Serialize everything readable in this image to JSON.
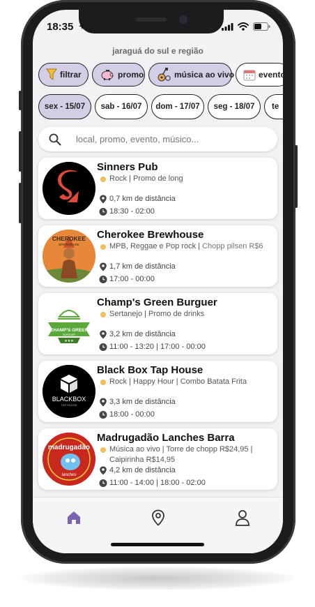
{
  "status": {
    "time": "18:35"
  },
  "region": "jaraguá do sul e região",
  "filters": [
    {
      "label": "filtrar",
      "icon": "funnel-icon",
      "active": true
    },
    {
      "label": "promo",
      "icon": "piggy-bank-icon",
      "active": true
    },
    {
      "label": "música ao vivo",
      "icon": "guitar-icon",
      "active": true
    },
    {
      "label": "evento",
      "icon": "calendar-icon",
      "active": false
    }
  ],
  "dates": [
    {
      "label": "sex - 15/07",
      "active": true
    },
    {
      "label": "sab - 16/07",
      "active": false
    },
    {
      "label": "dom - 17/07",
      "active": false
    },
    {
      "label": "seg - 18/07",
      "active": false
    },
    {
      "label": "te",
      "active": false
    }
  ],
  "search": {
    "placeholder": "local, promo, evento, músico..."
  },
  "venues": [
    {
      "name": "Sinners Pub",
      "tags": "Rock | Promo de long",
      "extra": "",
      "distance": "0,7 km de distância",
      "hours": "18:30 - 02:00"
    },
    {
      "name": "Cherokee Brewhouse",
      "tags": "MPB, Reggae e Pop rock | ",
      "extra": "Chopp pilsen R$6",
      "distance": "1,7 km de distância",
      "hours": "17:00 - 00:00"
    },
    {
      "name": "Champ's Green Burguer",
      "tags": "Sertanejo | Promo de drinks",
      "extra": "",
      "distance": "3,2 km de distância",
      "hours": "11:00 - 13:20 | 17:00 - 00:00"
    },
    {
      "name": "Black Box Tap House",
      "tags": "Rock | Happy Hour | Combo Batata Frita",
      "extra": "",
      "distance": "3,3 km de distância",
      "hours": "18:00 - 00:00"
    },
    {
      "name": "Madrugadão Lanches Barra",
      "tags": "Música ao vivo | Torre de chopp R$24,95 | Caipirinha R$14,95",
      "extra": "",
      "distance": "4,2 km de distância",
      "hours": "11:00 - 14:00 | 18:00 - 02:00"
    }
  ],
  "logos": {
    "cherokee": "CHEROKEE",
    "cherokee_sub": "BREWHOUSE",
    "champs": "CHAMP'S GREEN",
    "champs_sub": "BURGUER",
    "blackbox": "BLACKBOX",
    "blackbox_sub": "TAP HOUSE",
    "madrugadao": "madrugadão",
    "madrugadao_sub": "lanches"
  },
  "nav": [
    {
      "icon": "home-icon",
      "active": true
    },
    {
      "icon": "location-pin-icon",
      "active": false
    },
    {
      "icon": "user-icon",
      "active": false
    }
  ],
  "colors": {
    "accent": "#d3cde6",
    "nav_active": "#7a63b3",
    "tag_dot": "#f0c05a"
  }
}
